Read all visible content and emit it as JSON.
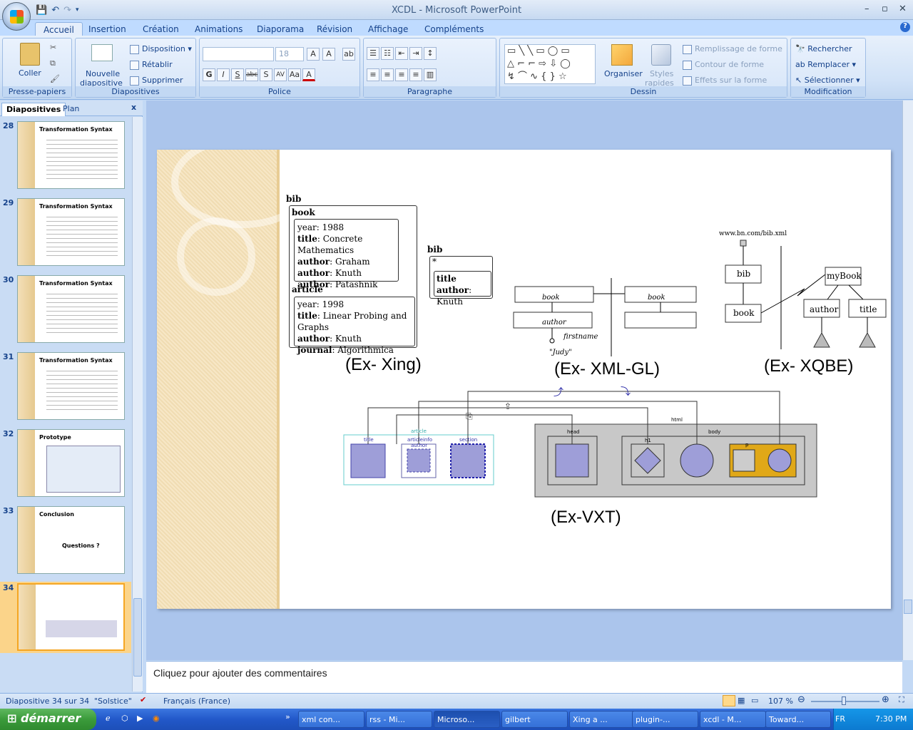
{
  "window": {
    "title": "XCDL - Microsoft PowerPoint"
  },
  "ribbon": {
    "tabs": [
      "Accueil",
      "Insertion",
      "Création",
      "Animations",
      "Diaporama",
      "Révision",
      "Affichage",
      "Compléments"
    ],
    "presse": {
      "coller": "Coller",
      "label": "Presse-papiers"
    },
    "diapos": {
      "nouvelle1": "Nouvelle",
      "nouvelle2": "diapositive",
      "disposition": "Disposition",
      "retablir": "Rétablir",
      "supprimer": "Supprimer",
      "label": "Diapositives"
    },
    "police": {
      "size": "18",
      "label": "Police",
      "bold": "G",
      "italic": "I",
      "underline": "S",
      "strike": "abc",
      "shadow": "S",
      "spacing": "AV",
      "case": "Aa",
      "color": "A"
    },
    "paragraphe": {
      "label": "Paragraphe"
    },
    "dessin": {
      "organiser": "Organiser",
      "styles1": "Styles",
      "styles2": "rapides",
      "remplissage": "Remplissage de forme",
      "contour": "Contour de forme",
      "effets": "Effets sur la forme",
      "label": "Dessin"
    },
    "modification": {
      "rechercher": "Rechercher",
      "remplacer": "Remplacer",
      "selectionner": "Sélectionner",
      "label": "Modification"
    }
  },
  "leftpane": {
    "tabs": [
      "Diapositives",
      "Plan"
    ],
    "close": "x",
    "slides": [
      {
        "num": "28",
        "title": "Transformation Syntax"
      },
      {
        "num": "29",
        "title": "Transformation Syntax"
      },
      {
        "num": "30",
        "title": "Transformation Syntax"
      },
      {
        "num": "31",
        "title": "Transformation Syntax"
      },
      {
        "num": "32",
        "title": "Prototype"
      },
      {
        "num": "33",
        "title": "Conclusion",
        "body": "Questions ?"
      },
      {
        "num": "34",
        "title": ""
      }
    ]
  },
  "slide": {
    "xing": {
      "bib": "bib",
      "book": "book",
      "book_rows": [
        [
          "year",
          ": 1988"
        ],
        [
          "title",
          ": Concrete Mathematics"
        ],
        [
          "author",
          ": Graham"
        ],
        [
          "author",
          ": Knuth"
        ],
        [
          "author",
          ": Patashnik"
        ]
      ],
      "article": "article",
      "article_rows": [
        [
          "year",
          ": 1998"
        ],
        [
          "title",
          ": Linear Probing and Graphs"
        ],
        [
          "author",
          ": Knuth"
        ],
        [
          "journal",
          ": Algorithmica"
        ]
      ],
      "bib2": "bib",
      "star": "*",
      "query_rows": [
        [
          "title",
          ""
        ],
        [
          "author",
          ": Knuth"
        ]
      ],
      "caption": "(Ex- Xing)"
    },
    "xmlgl": {
      "book1": "book",
      "author": "author",
      "firstname": "firstname",
      "judy": "\"Judy\"",
      "book2": "book",
      "caption": "(Ex- XML-GL)"
    },
    "xqbe": {
      "url": "www.bn.com/bib.xml",
      "bib": "bib",
      "book": "book",
      "mybook": "myBook",
      "author": "author",
      "title": "title",
      "caption": "(Ex- XQBE)"
    },
    "vxt": {
      "article": "article",
      "title": "title",
      "articleinfo": "articleinfo",
      "author": "author",
      "section": "section",
      "html": "html",
      "head": "head",
      "body": "body",
      "h1": "h1",
      "p": "p",
      "caption": "(Ex-VXT)"
    }
  },
  "notes": {
    "placeholder": "Cliquez pour ajouter des commentaires"
  },
  "status": {
    "slide": "Diapositive 34 sur 34",
    "theme": "\"Solstice\"",
    "lang": "Français (France)",
    "zoom": "107 %"
  },
  "taskbar": {
    "start": "démarrer",
    "tasks": [
      "xml con...",
      "rss - Mi...",
      "Microso...",
      "gilbert",
      "Xing a ...",
      "plugin-...",
      "xcdl - M...",
      "Toward..."
    ],
    "lang": "FR",
    "time": "7:30 PM"
  }
}
